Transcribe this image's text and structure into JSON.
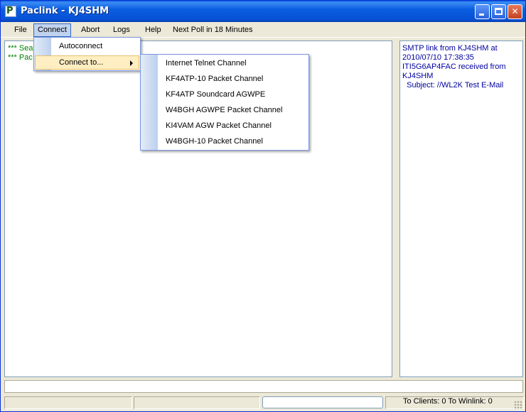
{
  "window": {
    "title": "Paclink - KJ4SHM",
    "app_icon_letter": "P"
  },
  "menubar": {
    "items": [
      {
        "label": "File"
      },
      {
        "label": "Connect"
      },
      {
        "label": "Abort"
      },
      {
        "label": "Logs"
      },
      {
        "label": "Help"
      },
      {
        "label": "Next Poll in 18 Minutes"
      }
    ]
  },
  "connect_menu": {
    "items": [
      {
        "label": "Autoconnect"
      },
      {
        "label": "Connect to..."
      }
    ]
  },
  "connect_to_submenu": {
    "items": [
      {
        "label": "Internet Telnet Channel"
      },
      {
        "label": "KF4ATP-10 Packet Channel"
      },
      {
        "label": "KF4ATP Soundcard AGWPE"
      },
      {
        "label": "W4BGH AGWPE Packet Channel"
      },
      {
        "label": "KI4VAM AGW Packet Channel"
      },
      {
        "label": "W4BGH-10 Packet Channel"
      }
    ]
  },
  "log_pane": {
    "lines": [
      {
        "text": "*** Sea"
      },
      {
        "text": "*** Pac"
      }
    ]
  },
  "smtp_pane": {
    "lines": [
      {
        "text": "SMTP link from KJ4SHM at"
      },
      {
        "text": "2010/07/10 17:38:35"
      },
      {
        "text": "ITI5G6AP4FAC received from"
      },
      {
        "text": "KJ4SHM"
      },
      {
        "text": "  Subject: //WL2K Test E-Mail"
      }
    ]
  },
  "statusbar": {
    "counts": "To Clients: 0  To Winlink: 0"
  },
  "colors": {
    "titlebar": "#0b5ee0",
    "menu_highlight": "#ffeec2",
    "log_text": "#008000",
    "smtp_text": "#0000a0"
  }
}
